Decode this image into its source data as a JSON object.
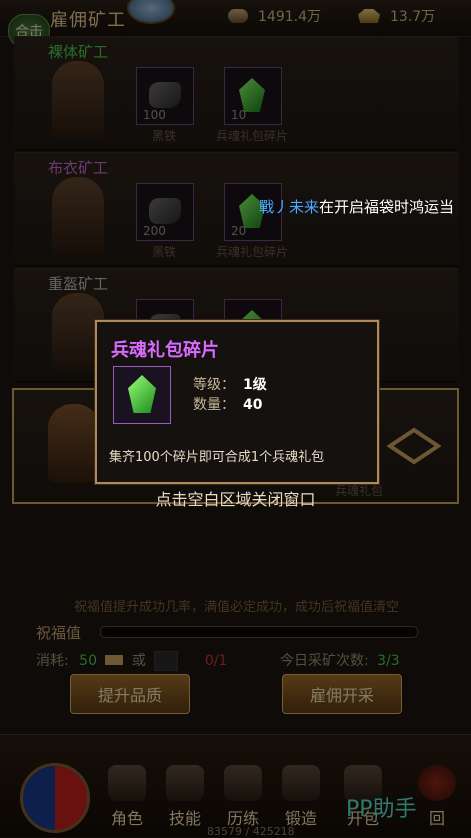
{
  "header": {
    "hit_label": "合击",
    "title": "雇佣矿工",
    "coins": "1491.4万",
    "gold": "13.7万"
  },
  "miners": [
    {
      "name": "裸体矿工",
      "name_color": "#4ac84a",
      "slots": [
        {
          "count": "100",
          "label": "黑铁",
          "kind": "ore"
        },
        {
          "count": "10",
          "label": "兵魂礼包碎片",
          "kind": "gem"
        }
      ]
    },
    {
      "name": "布衣矿工",
      "name_color": "#c86ac8",
      "slots": [
        {
          "count": "200",
          "label": "黑铁",
          "kind": "ore"
        },
        {
          "count": "20",
          "label": "兵魂礼包碎片",
          "kind": "gem"
        }
      ]
    },
    {
      "name": "重盔矿工",
      "name_color": "#b8b8b8",
      "slots": [
        {
          "count": "",
          "label": "",
          "kind": "ore"
        },
        {
          "count": "",
          "label": "",
          "kind": "gem"
        }
      ]
    },
    {
      "name": "",
      "name_color": "#e03030",
      "slots": [
        {
          "count": "",
          "label": "",
          "kind": "gem"
        },
        {
          "count": "",
          "label": "兵魂礼包",
          "kind": "gem"
        }
      ]
    }
  ],
  "broadcast": {
    "player": "戰丿未来",
    "message": "在开启福袋时鸿运当"
  },
  "tooltip": {
    "title": "兵魂礼包碎片",
    "level_label": "等级：",
    "level_value": "1级",
    "qty_label": "数量：",
    "qty_value": "40",
    "description": "集齐100个碎片即可合成1个兵魂礼包"
  },
  "close_hint": "点击空白区域关闭窗口",
  "bless": {
    "tip": "祝福值提升成功几率，满值必定成功，成功后祝福值清空",
    "label": "祝福值",
    "cost_label": "消耗:",
    "cost_value": "50",
    "or_label": "或",
    "fraction": "0/1",
    "daily_label": "今日采矿次数:",
    "daily_value": "3/3",
    "upgrade_button": "提升品质",
    "hire_button": "雇佣开采"
  },
  "nav": {
    "items": [
      "角色",
      "技能",
      "历练",
      "锻造",
      "开包",
      "回"
    ],
    "exp": "83579 / 425218",
    "watermark": "PP助手"
  }
}
